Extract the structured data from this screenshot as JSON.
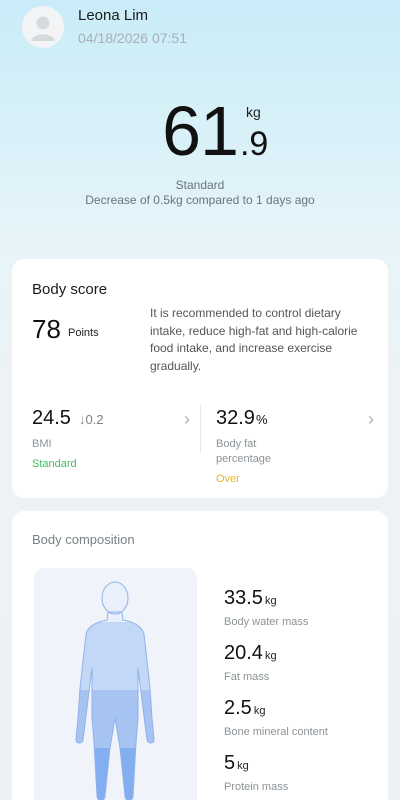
{
  "user": {
    "name": "Leona Lim",
    "datetime": "04/18/2026 07:51"
  },
  "weight": {
    "integer": "61",
    "decimal": ".9",
    "unit": "kg",
    "status": "Standard",
    "change": "Decrease of 0.5kg compared to 1 days ago"
  },
  "score_card": {
    "title": "Body score",
    "score": "78",
    "score_unit": "Points",
    "advice": "It is recommended to control dietary intake, reduce high-fat and high-calorie food intake, and increase exercise gradually."
  },
  "metrics": {
    "bmi": {
      "value": "24.5",
      "delta": "↓0.2",
      "label": "BMI",
      "status": "Standard",
      "status_color": "#3fbf5a"
    },
    "body_fat": {
      "value": "32.9",
      "unit": "%",
      "label": "Body fat percentage",
      "status": "Over",
      "status_color": "#e8b42a"
    }
  },
  "composition": {
    "title": "Body composition",
    "items": [
      {
        "value": "33.5",
        "unit": "kg",
        "label": "Body water mass"
      },
      {
        "value": "20.4",
        "unit": "kg",
        "label": "Fat mass"
      },
      {
        "value": "2.5",
        "unit": "kg",
        "label": "Bone mineral content"
      },
      {
        "value": "5",
        "unit": "kg",
        "label": "Protein mass"
      }
    ]
  },
  "icons": {
    "avatar": "person-avatar-icon",
    "chevron": "chevron-right-icon",
    "body": "body-silhouette-icon"
  },
  "colors": {
    "standard_green": "#3fbf5a",
    "over_yellow": "#e8b42a",
    "body_fill_light": "#c9dcf7",
    "body_fill_mid": "#a8c6f4",
    "body_fill_dark": "#7fa9ee"
  }
}
